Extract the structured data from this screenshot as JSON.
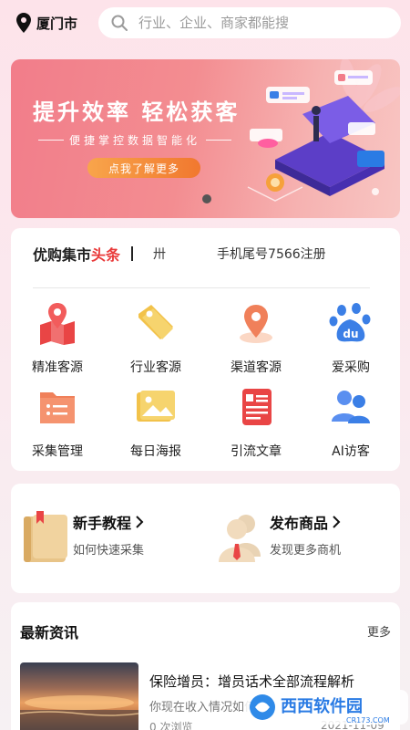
{
  "location": {
    "city": "厦门市"
  },
  "search": {
    "placeholder": "行业、企业、商家都能搜"
  },
  "banner": {
    "headline": "提升效率 轻松获客",
    "subline": "便捷掌控数据智能化",
    "cta": "点我了解更多"
  },
  "ticker": {
    "brand": "优购集市",
    "highlight": "头条",
    "prev_fragment": "卅",
    "message": "手机尾号7566注册"
  },
  "grid": {
    "items": [
      {
        "label": "精准客源",
        "icon": "map-icon"
      },
      {
        "label": "行业客源",
        "icon": "tag-icon"
      },
      {
        "label": "渠道客源",
        "icon": "location-icon"
      },
      {
        "label": "爱采购",
        "icon": "baidu-paw-icon"
      },
      {
        "label": "采集管理",
        "icon": "folder-icon"
      },
      {
        "label": "每日海报",
        "icon": "picture-icon"
      },
      {
        "label": "引流文章",
        "icon": "document-icon"
      },
      {
        "label": "AI访客",
        "icon": "users-icon"
      }
    ]
  },
  "features": {
    "tutorial": {
      "title": "新手教程",
      "subtitle": "如何快速采集"
    },
    "publish": {
      "title": "发布商品",
      "subtitle": "发现更多商机"
    }
  },
  "news": {
    "section_title": "最新资讯",
    "more": "更多",
    "article": {
      "title": "保险增员：增员话术全部流程解析",
      "summary": "你现在收入情况如何",
      "views": "0 次浏览",
      "date": "2021-11-09"
    }
  },
  "watermark": {
    "text": "西西软件园",
    "domain": "CR173.COM"
  },
  "colors": {
    "accent_red": "#e93a3a",
    "banner_start": "#f27d8a",
    "cta_orange": "#f1782f",
    "icon_blue": "#3b7fe6",
    "icon_yellow": "#f2c24a"
  }
}
